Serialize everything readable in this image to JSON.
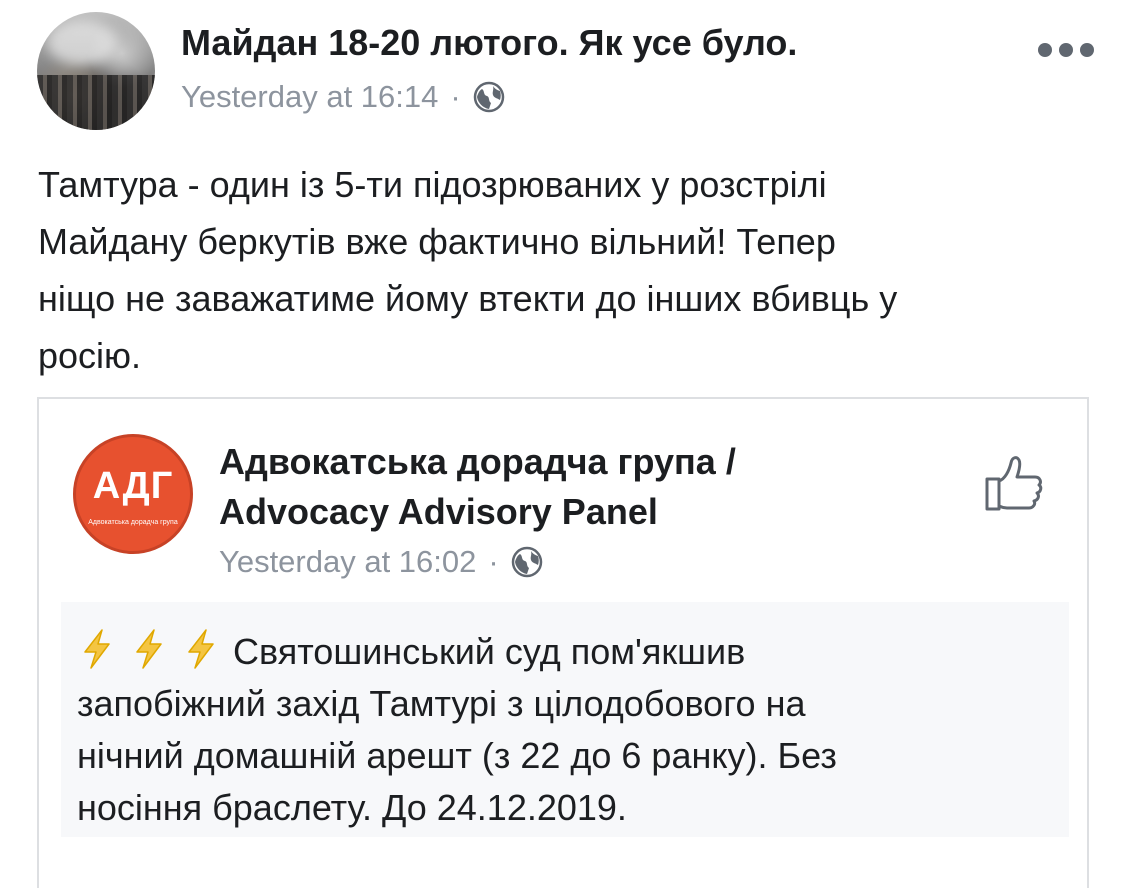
{
  "post": {
    "title": "Майдан 18-20 лютого. Як усе було.",
    "timestamp": "Yesterday at 16:14",
    "separator": "·",
    "privacy_icon": "globe-icon",
    "more_icon": "more-options-icon",
    "text_lines": [
      "Тамтура - один із 5-ти підозрюваних у розстрілі",
      "Майдану беркутів вже фактично вільний! Тепер",
      "ніщо не заважатиме йому втекти до інших вбивць у",
      "росію."
    ]
  },
  "shared": {
    "logo_text": "АДГ",
    "logo_subtext": "Адвокатська дорадча група",
    "name_lines": [
      "Адвокатська дорадча група /",
      "Advocacy Advisory Panel"
    ],
    "timestamp": "Yesterday at 16:02",
    "separator": "·",
    "like_icon": "thumbs-up-icon",
    "text_lines": [
      "Святошинський суд пом'якшив",
      "запобіжний захід Тамтурі з цілодобового на",
      "нічний домашній арешт (з 22 до 6 ранку). Без",
      "носіння браслету. До 24.12.2019."
    ]
  },
  "colors": {
    "text": "#1c1e21",
    "meta": "#8d949e",
    "logo": "#e7512f",
    "bolt": "#f4c542"
  }
}
